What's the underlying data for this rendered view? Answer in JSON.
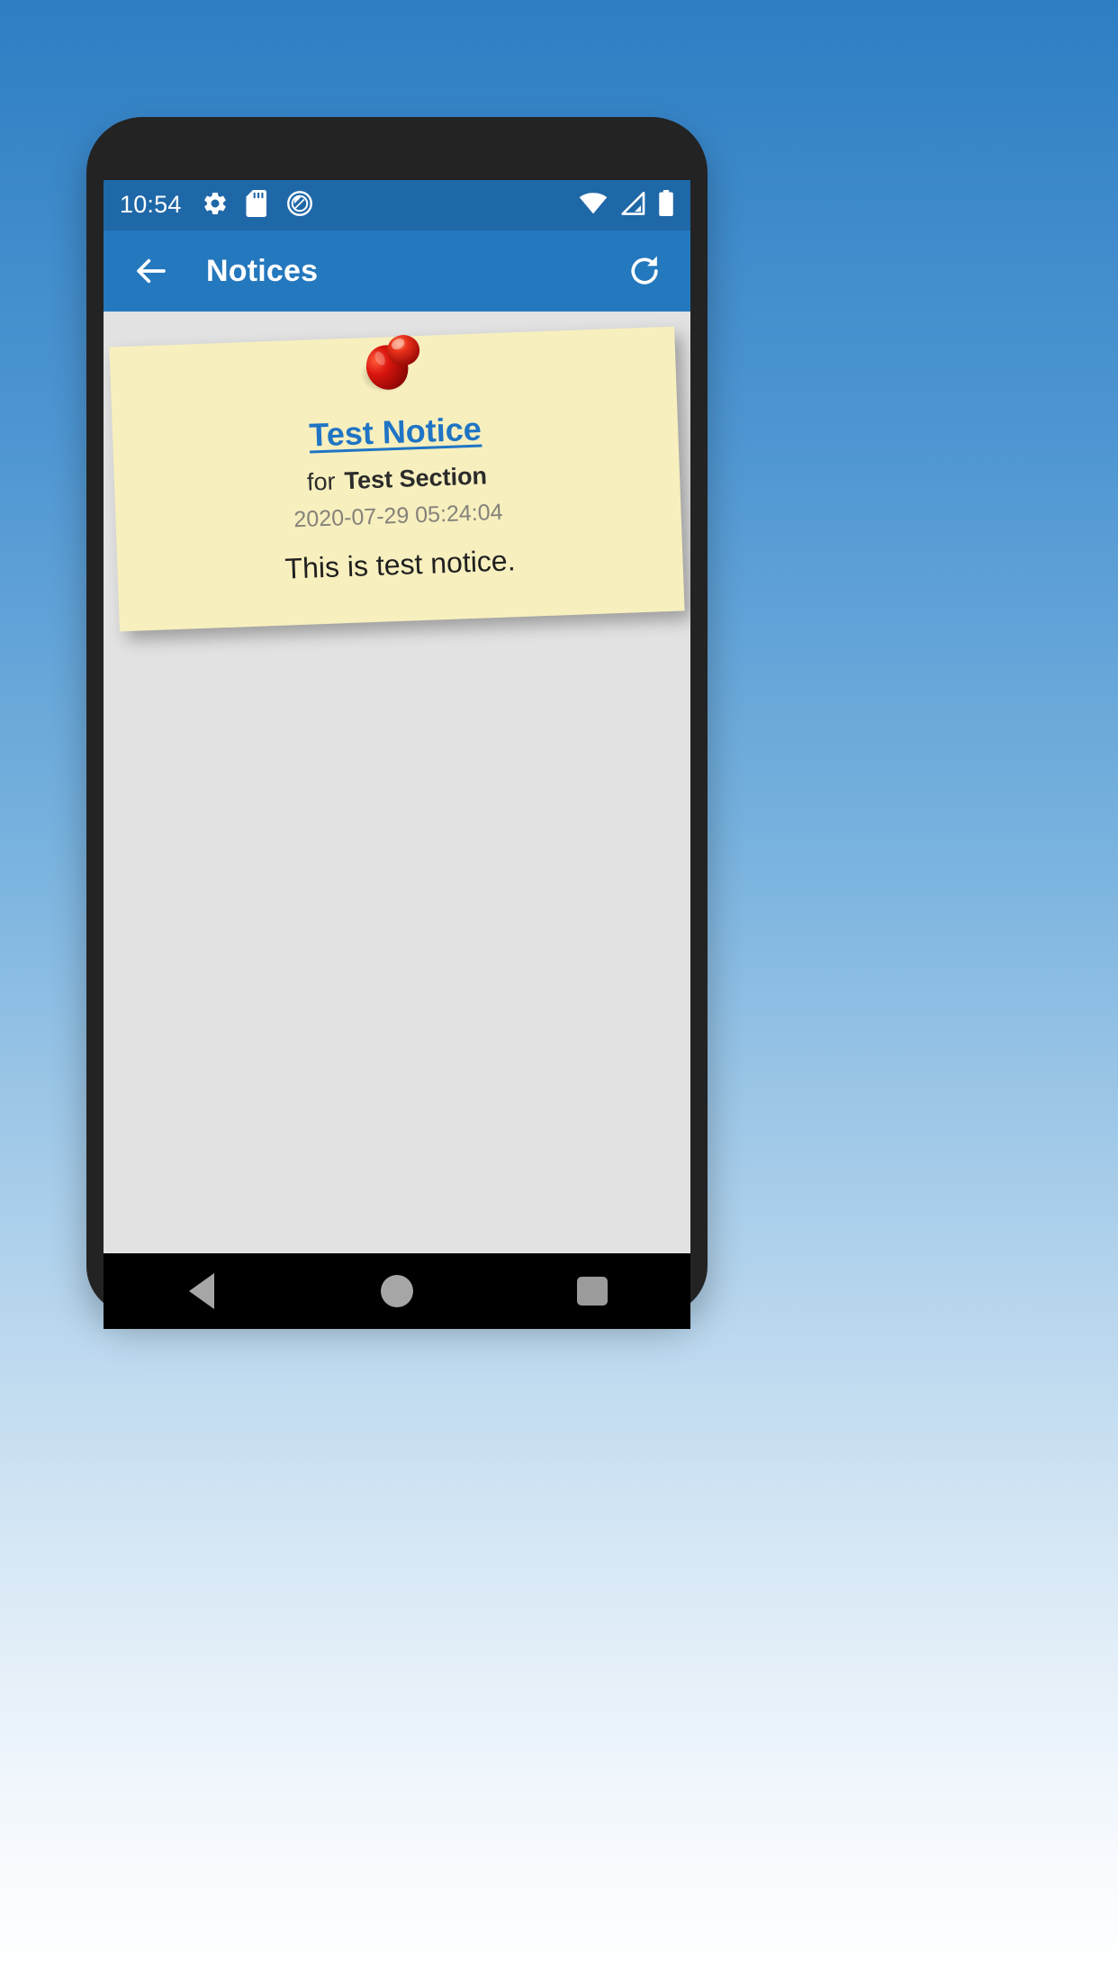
{
  "status_bar": {
    "clock": "10:54",
    "left_icons": [
      "gear-icon",
      "sd-card-icon",
      "do-not-disturb-icon"
    ],
    "right_icons": [
      "wifi-icon",
      "cell-signal-icon",
      "battery-icon"
    ],
    "background_color": "#1f68a8"
  },
  "app_bar": {
    "back_icon": "arrow-left-icon",
    "title": "Notices",
    "refresh_icon": "refresh-icon",
    "background_color": "#2478bd",
    "text_color": "#ffffff"
  },
  "content": {
    "background_color": "#e2e2e2",
    "notices": [
      {
        "pin_icon": "pushpin-icon",
        "title": "Test Notice",
        "for_label": "for",
        "section": "Test Section",
        "timestamp": "2020-07-29 05:24:04",
        "body": "This is test notice.",
        "card_color": "#f7efbe",
        "title_color": "#1f74c4",
        "timestamp_color": "#85827a"
      }
    ]
  },
  "nav_bar": {
    "back_icon": "triangle-back-icon",
    "home_icon": "circle-home-icon",
    "recents_icon": "square-recents-icon",
    "background_color": "#000000",
    "icon_color": "#a6a6a6"
  }
}
